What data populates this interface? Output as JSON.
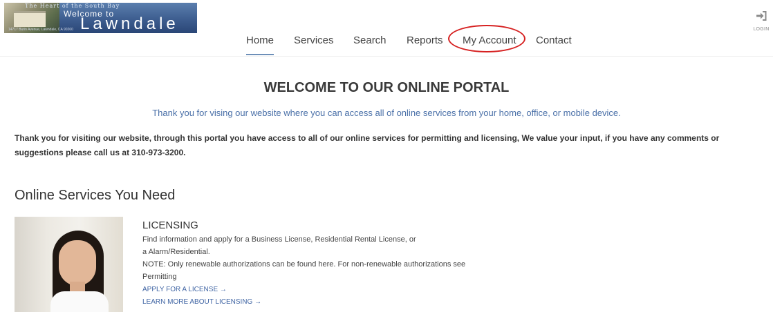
{
  "header": {
    "logo": {
      "tagline": "The Heart of the South Bay",
      "welcome": "Welcome to",
      "city": "Lawndale",
      "address": "14717 Burin Avenue, Lawndale, CA 90260"
    },
    "login_label": "LOGIN"
  },
  "nav": {
    "items": [
      {
        "label": "Home"
      },
      {
        "label": "Services"
      },
      {
        "label": "Search"
      },
      {
        "label": "Reports"
      },
      {
        "label": "My Account"
      },
      {
        "label": "Contact"
      }
    ],
    "active": "Home"
  },
  "main": {
    "title": "WELCOME TO OUR ONLINE PORTAL",
    "subtitle": "Thank you for vising our website where you can access all of online services from your home, office, or mobile device.",
    "intro_line1": "Thank you for visiting our website, through this portal you have access to all of our online services for permitting and licensing, We value your input, if you have any comments or",
    "intro_line2": "suggestions please call us at 310-973-3200.",
    "section_title": "Online Services You Need",
    "licensing": {
      "heading": "LICENSING",
      "lines": [
        "Find information and apply for a Business License, Residential Rental License, or",
        "a Alarm/Residential.",
        "NOTE: Only renewable authorizations can be found here. For non-renewable authorizations see",
        "Permitting"
      ],
      "apply_link": "APPLY FOR A LICENSE →",
      "learn_link": "LEARN MORE ABOUT LICENSING →"
    }
  },
  "colors": {
    "accent": "#4a70a8",
    "nav_active": "#6d8fb8",
    "highlight_ring": "#d62020"
  }
}
